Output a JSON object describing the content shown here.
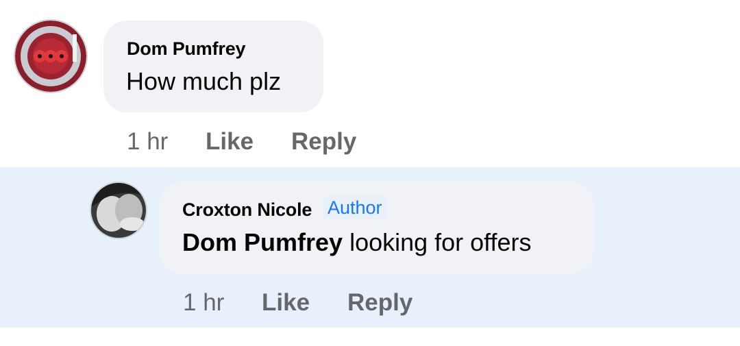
{
  "comments": [
    {
      "author": "Dom Pumfrey",
      "text": "How much plz",
      "time": "1 hr",
      "like_label": "Like",
      "reply_label": "Reply",
      "avatar_icon": "poppy-badge-avatar"
    },
    {
      "author": "Croxton Nicole",
      "badge": "Author",
      "mention": "Dom Pumfrey",
      "text": " looking for offers",
      "time": "1 hr",
      "like_label": "Like",
      "reply_label": "Reply",
      "avatar_icon": "profile-photo-avatar",
      "highlight_color": "#e7f0fb"
    }
  ]
}
